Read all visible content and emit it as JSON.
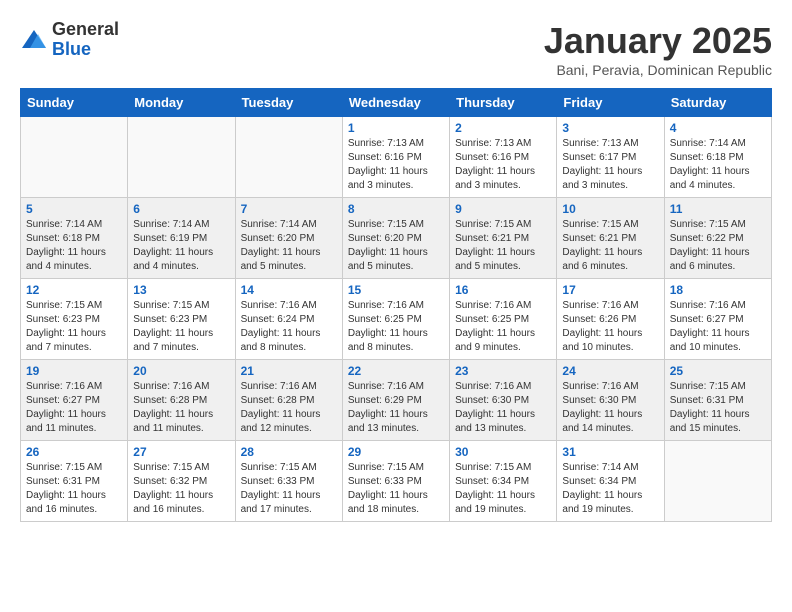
{
  "logo": {
    "general": "General",
    "blue": "Blue"
  },
  "title": "January 2025",
  "subtitle": "Bani, Peravia, Dominican Republic",
  "weekdays": [
    "Sunday",
    "Monday",
    "Tuesday",
    "Wednesday",
    "Thursday",
    "Friday",
    "Saturday"
  ],
  "weeks": [
    [
      {
        "day": "",
        "info": ""
      },
      {
        "day": "",
        "info": ""
      },
      {
        "day": "",
        "info": ""
      },
      {
        "day": "1",
        "info": "Sunrise: 7:13 AM\nSunset: 6:16 PM\nDaylight: 11 hours\nand 3 minutes."
      },
      {
        "day": "2",
        "info": "Sunrise: 7:13 AM\nSunset: 6:16 PM\nDaylight: 11 hours\nand 3 minutes."
      },
      {
        "day": "3",
        "info": "Sunrise: 7:13 AM\nSunset: 6:17 PM\nDaylight: 11 hours\nand 3 minutes."
      },
      {
        "day": "4",
        "info": "Sunrise: 7:14 AM\nSunset: 6:18 PM\nDaylight: 11 hours\nand 4 minutes."
      }
    ],
    [
      {
        "day": "5",
        "info": "Sunrise: 7:14 AM\nSunset: 6:18 PM\nDaylight: 11 hours\nand 4 minutes."
      },
      {
        "day": "6",
        "info": "Sunrise: 7:14 AM\nSunset: 6:19 PM\nDaylight: 11 hours\nand 4 minutes."
      },
      {
        "day": "7",
        "info": "Sunrise: 7:14 AM\nSunset: 6:20 PM\nDaylight: 11 hours\nand 5 minutes."
      },
      {
        "day": "8",
        "info": "Sunrise: 7:15 AM\nSunset: 6:20 PM\nDaylight: 11 hours\nand 5 minutes."
      },
      {
        "day": "9",
        "info": "Sunrise: 7:15 AM\nSunset: 6:21 PM\nDaylight: 11 hours\nand 5 minutes."
      },
      {
        "day": "10",
        "info": "Sunrise: 7:15 AM\nSunset: 6:21 PM\nDaylight: 11 hours\nand 6 minutes."
      },
      {
        "day": "11",
        "info": "Sunrise: 7:15 AM\nSunset: 6:22 PM\nDaylight: 11 hours\nand 6 minutes."
      }
    ],
    [
      {
        "day": "12",
        "info": "Sunrise: 7:15 AM\nSunset: 6:23 PM\nDaylight: 11 hours\nand 7 minutes."
      },
      {
        "day": "13",
        "info": "Sunrise: 7:15 AM\nSunset: 6:23 PM\nDaylight: 11 hours\nand 7 minutes."
      },
      {
        "day": "14",
        "info": "Sunrise: 7:16 AM\nSunset: 6:24 PM\nDaylight: 11 hours\nand 8 minutes."
      },
      {
        "day": "15",
        "info": "Sunrise: 7:16 AM\nSunset: 6:25 PM\nDaylight: 11 hours\nand 8 minutes."
      },
      {
        "day": "16",
        "info": "Sunrise: 7:16 AM\nSunset: 6:25 PM\nDaylight: 11 hours\nand 9 minutes."
      },
      {
        "day": "17",
        "info": "Sunrise: 7:16 AM\nSunset: 6:26 PM\nDaylight: 11 hours\nand 10 minutes."
      },
      {
        "day": "18",
        "info": "Sunrise: 7:16 AM\nSunset: 6:27 PM\nDaylight: 11 hours\nand 10 minutes."
      }
    ],
    [
      {
        "day": "19",
        "info": "Sunrise: 7:16 AM\nSunset: 6:27 PM\nDaylight: 11 hours\nand 11 minutes."
      },
      {
        "day": "20",
        "info": "Sunrise: 7:16 AM\nSunset: 6:28 PM\nDaylight: 11 hours\nand 11 minutes."
      },
      {
        "day": "21",
        "info": "Sunrise: 7:16 AM\nSunset: 6:28 PM\nDaylight: 11 hours\nand 12 minutes."
      },
      {
        "day": "22",
        "info": "Sunrise: 7:16 AM\nSunset: 6:29 PM\nDaylight: 11 hours\nand 13 minutes."
      },
      {
        "day": "23",
        "info": "Sunrise: 7:16 AM\nSunset: 6:30 PM\nDaylight: 11 hours\nand 13 minutes."
      },
      {
        "day": "24",
        "info": "Sunrise: 7:16 AM\nSunset: 6:30 PM\nDaylight: 11 hours\nand 14 minutes."
      },
      {
        "day": "25",
        "info": "Sunrise: 7:15 AM\nSunset: 6:31 PM\nDaylight: 11 hours\nand 15 minutes."
      }
    ],
    [
      {
        "day": "26",
        "info": "Sunrise: 7:15 AM\nSunset: 6:31 PM\nDaylight: 11 hours\nand 16 minutes."
      },
      {
        "day": "27",
        "info": "Sunrise: 7:15 AM\nSunset: 6:32 PM\nDaylight: 11 hours\nand 16 minutes."
      },
      {
        "day": "28",
        "info": "Sunrise: 7:15 AM\nSunset: 6:33 PM\nDaylight: 11 hours\nand 17 minutes."
      },
      {
        "day": "29",
        "info": "Sunrise: 7:15 AM\nSunset: 6:33 PM\nDaylight: 11 hours\nand 18 minutes."
      },
      {
        "day": "30",
        "info": "Sunrise: 7:15 AM\nSunset: 6:34 PM\nDaylight: 11 hours\nand 19 minutes."
      },
      {
        "day": "31",
        "info": "Sunrise: 7:14 AM\nSunset: 6:34 PM\nDaylight: 11 hours\nand 19 minutes."
      },
      {
        "day": "",
        "info": ""
      }
    ]
  ]
}
